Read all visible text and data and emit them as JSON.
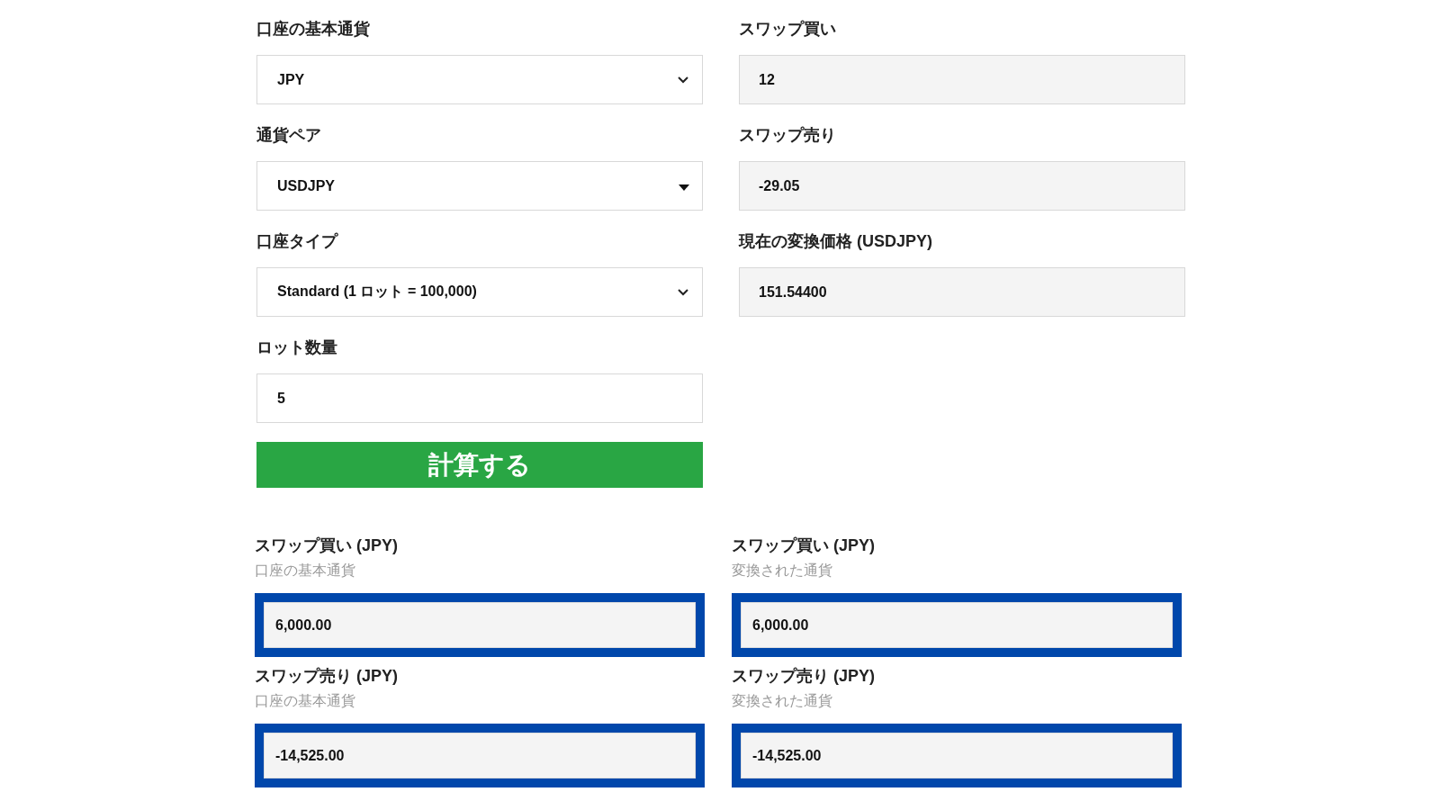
{
  "inputs_left": [
    {
      "label": "口座の基本通貨",
      "kind": "select",
      "value": "JPY"
    },
    {
      "label": "通貨ペア",
      "kind": "combobox",
      "value": "USDJPY"
    },
    {
      "label": "口座タイプ",
      "kind": "select",
      "value": "Standard (1 ロット = 100,000)"
    },
    {
      "label": "ロット数量",
      "kind": "input",
      "value": "5"
    }
  ],
  "calculate_button": "計算する",
  "inputs_right": [
    {
      "label": "スワップ買い",
      "kind": "readonly",
      "value": "12"
    },
    {
      "label": "スワップ売り",
      "kind": "readonly",
      "value": "-29.05"
    },
    {
      "label": "現在の変換価格 (USDJPY)",
      "kind": "readonly",
      "value": "151.54400"
    }
  ],
  "results": [
    {
      "label": "スワップ買い (JPY)",
      "sublabel": "口座の基本通貨",
      "value": "6,000.00",
      "highlighted": true
    },
    {
      "label": "スワップ買い (JPY)",
      "sublabel": "変換された通貨",
      "value": "6,000.00",
      "highlighted": true
    },
    {
      "label": "スワップ売り (JPY)",
      "sublabel": "口座の基本通貨",
      "value": "-14,525.00",
      "highlighted": true
    },
    {
      "label": "スワップ売り (JPY)",
      "sublabel": "変換された通貨",
      "value": "-14,525.00",
      "highlighted": true
    }
  ]
}
